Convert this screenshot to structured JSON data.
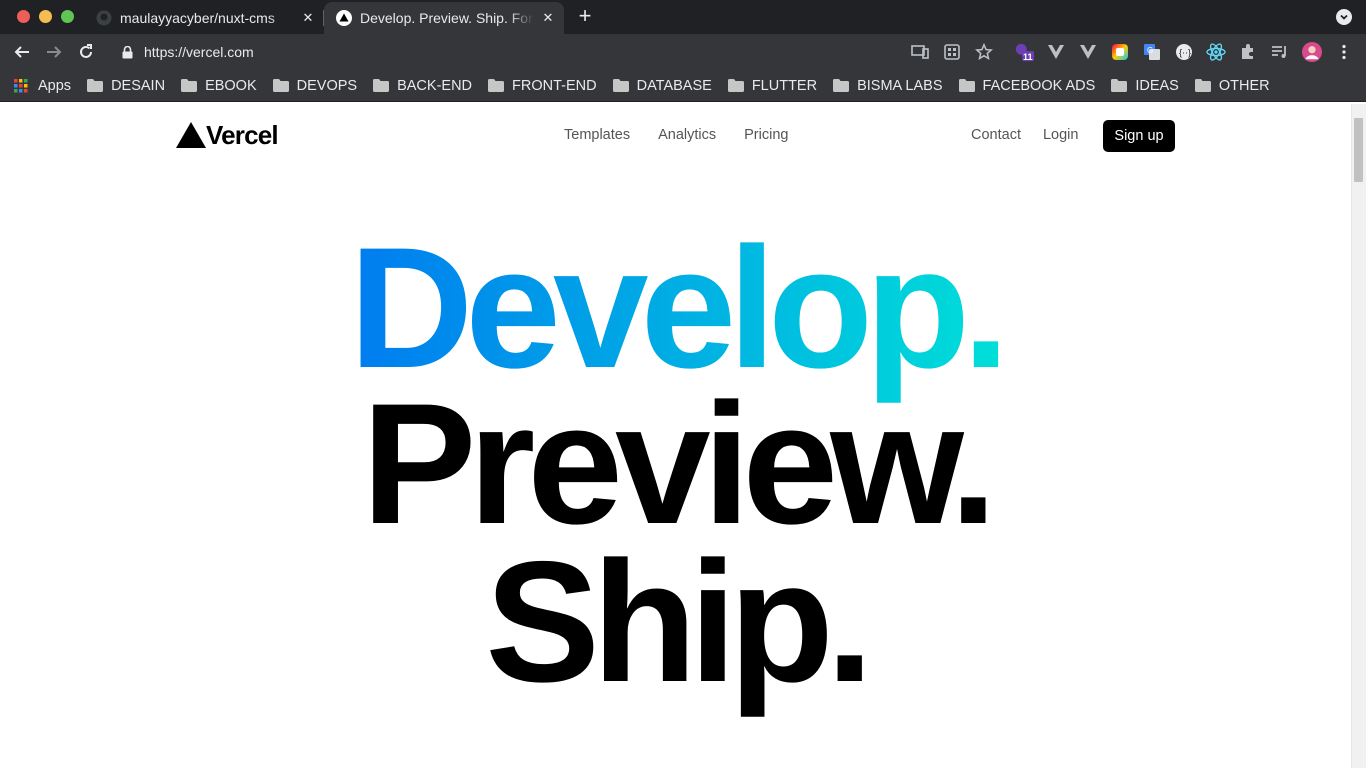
{
  "browser": {
    "tabs": [
      {
        "title": "maulayyacyber/nuxt-cms",
        "favicon": "github-icon",
        "active": false
      },
      {
        "title": "Develop. Preview. Ship. For",
        "favicon": "vercel-triangle-icon",
        "active": true
      }
    ],
    "new_tab_label": "+",
    "url": "https://vercel.com",
    "extension_badge": "11",
    "bookmarks": [
      {
        "label": "Apps",
        "icon": "apps-grid-icon"
      },
      {
        "label": "DESAIN",
        "icon": "folder-icon"
      },
      {
        "label": "EBOOK",
        "icon": "folder-icon"
      },
      {
        "label": "DEVOPS",
        "icon": "folder-icon"
      },
      {
        "label": "BACK-END",
        "icon": "folder-icon"
      },
      {
        "label": "FRONT-END",
        "icon": "folder-icon"
      },
      {
        "label": "DATABASE",
        "icon": "folder-icon"
      },
      {
        "label": "FLUTTER",
        "icon": "folder-icon"
      },
      {
        "label": "BISMA LABS",
        "icon": "folder-icon"
      },
      {
        "label": "FACEBOOK ADS",
        "icon": "folder-icon"
      },
      {
        "label": "IDEAS",
        "icon": "folder-icon"
      },
      {
        "label": "OTHER",
        "icon": "folder-icon"
      }
    ]
  },
  "site": {
    "logo_text": "Vercel",
    "nav_center": [
      "Templates",
      "Analytics",
      "Pricing"
    ],
    "nav_right": [
      "Contact",
      "Login"
    ],
    "signup_label": "Sign up",
    "hero": [
      "Develop.",
      "Preview.",
      "Ship."
    ],
    "gradient": {
      "from": "#007cf0",
      "to": "#00dfd8"
    }
  }
}
